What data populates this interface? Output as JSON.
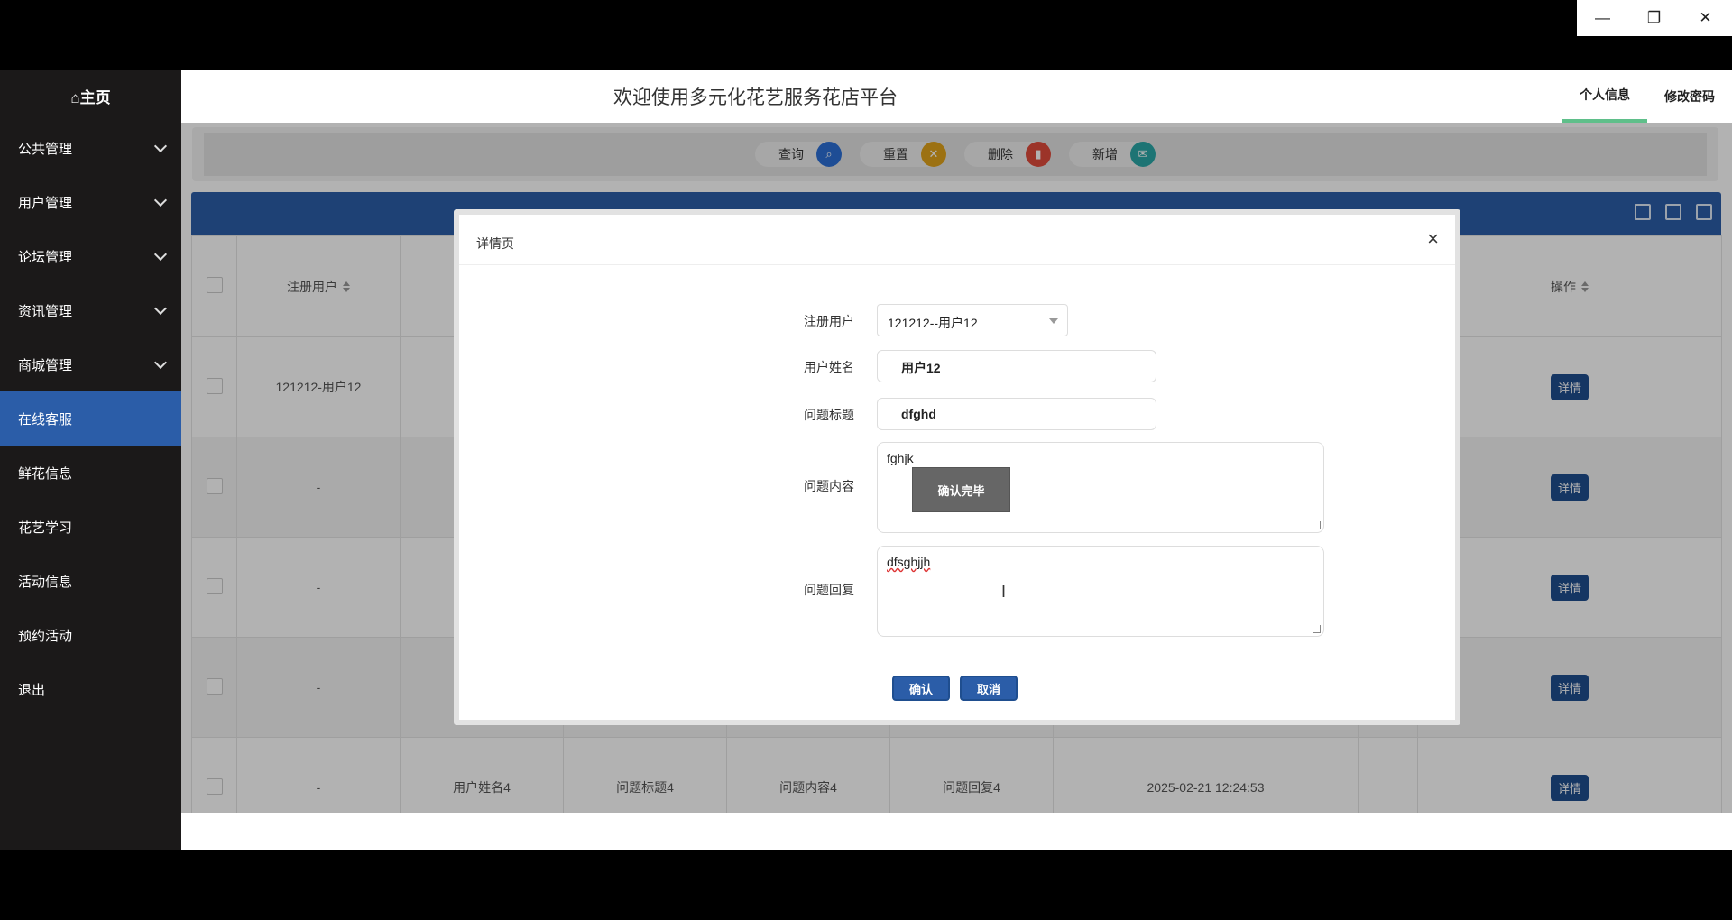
{
  "window": {
    "minimize": "—",
    "restore": "❐",
    "close": "✕"
  },
  "sidebar": {
    "home": "⌂主页",
    "items": [
      {
        "label": "公共管理",
        "expandable": true
      },
      {
        "label": "用户管理",
        "expandable": true
      },
      {
        "label": "论坛管理",
        "expandable": true
      },
      {
        "label": "资讯管理",
        "expandable": true
      },
      {
        "label": "商城管理",
        "expandable": true
      },
      {
        "label": "在线客服",
        "active": true
      },
      {
        "label": "鲜花信息"
      },
      {
        "label": "花艺学习"
      },
      {
        "label": "活动信息"
      },
      {
        "label": "预约活动"
      },
      {
        "label": "退出"
      }
    ]
  },
  "header": {
    "title": "欢迎使用多元化花艺服务花店平台",
    "profile": "个人信息",
    "change_password": "修改密码"
  },
  "search": {
    "query": "查询",
    "reset": "重置",
    "delete": "删除",
    "add": "新增"
  },
  "table": {
    "headers": [
      "注册用户",
      "操作"
    ],
    "detail_label": "详情",
    "rows": [
      {
        "user": "121212-用户12"
      },
      {
        "user": "-"
      },
      {
        "user": "-"
      },
      {
        "user": "-"
      },
      {
        "user": "-",
        "name": "用户姓名4",
        "title": "问题标题4",
        "content": "问题内容4",
        "reply": "问题回复4",
        "time": "2025-02-21 12:24:53"
      }
    ]
  },
  "dialog": {
    "title": "详情页",
    "close": "×",
    "fields": {
      "user_label": "注册用户",
      "user_value": "121212--用户12",
      "name_label": "用户姓名",
      "name_value": "用户12",
      "title_label": "问题标题",
      "title_value": "dfghd",
      "content_label": "问题内容",
      "content_value": "fghjk",
      "reply_label": "问题回复",
      "reply_value": "dfsghjjh"
    },
    "confirm_popup": "确认完毕",
    "ok": "确认",
    "cancel": "取消"
  },
  "colors": {
    "primary": "#2b5da8",
    "sidebar": "#1b1919",
    "accent_green": "#5fbf8a"
  }
}
